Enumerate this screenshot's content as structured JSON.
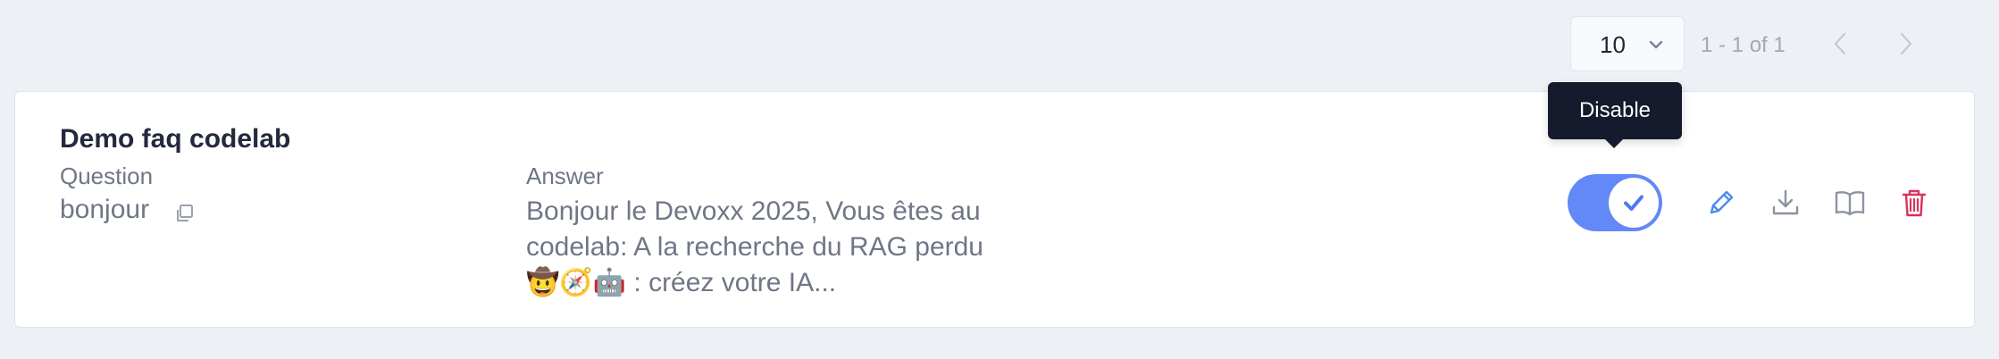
{
  "pagination": {
    "page_size": "10",
    "range_text": "1 - 1 of 1",
    "icons": {
      "dropdown": "chevron-down-icon",
      "prev": "chevron-left-icon",
      "next": "chevron-right-icon"
    }
  },
  "card": {
    "title": "Demo faq codelab",
    "question_label": "Question",
    "question_value": "bonjour",
    "answer_label": "Answer",
    "answer_value": "Bonjour le Devoxx 2025, Vous êtes au codelab: A la recherche du RAG perdu 🤠🧭🤖 : créez votre IA...",
    "tooltip": "Disable",
    "toggle_enabled": true,
    "icons": {
      "copy": "copy-icon",
      "edit": "pencil-icon",
      "download": "download-icon",
      "book": "book-icon",
      "delete": "trash-icon"
    }
  },
  "colors": {
    "toggle_on": "#6388f7",
    "edit_icon": "#4e89f2",
    "delete_icon": "#d8335b",
    "tooltip_bg": "#151a2c",
    "page_bg": "#edf0f5"
  }
}
